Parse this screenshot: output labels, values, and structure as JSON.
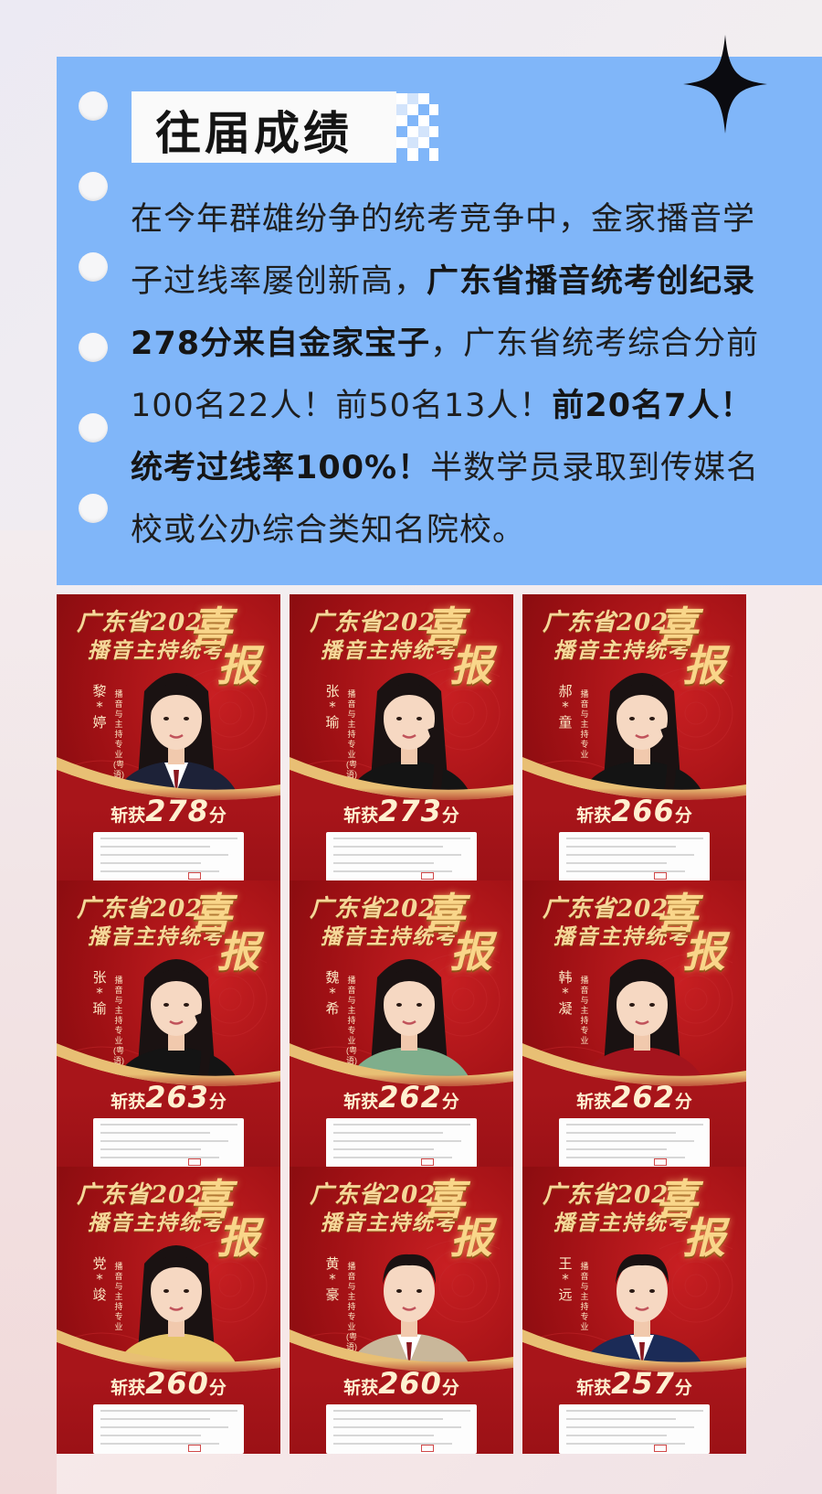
{
  "section": {
    "title": "往届成绩",
    "paragraph": [
      {
        "text": "在今年群雄纷争的统考竞争中，金家播音学子过线率屡创新高，",
        "bold": false
      },
      {
        "text": "广东省播音统考创纪录278分来自金家宝子",
        "bold": true
      },
      {
        "text": "，广东省统考综合分前100名22人！前50名13人！",
        "bold": false
      },
      {
        "text": "前20名7人！统考过线率100%！",
        "bold": true
      },
      {
        "text": "半数学员录取到传媒名校或公办综合类知名院校。",
        "bold": false
      }
    ]
  },
  "poster_common": {
    "line1": "广东省2024",
    "line2": "播音主持统考",
    "xi": "喜",
    "bao": "报",
    "prefix": "斩获",
    "suffix": "分"
  },
  "posters": [
    {
      "name": "黎*婷",
      "major": "播音与主持专业(粤语)",
      "score": "278",
      "hair": "long",
      "outfit": "suit"
    },
    {
      "name": "张*瑜",
      "major": "播音与主持专业(粤语)",
      "score": "273",
      "hair": "braid",
      "outfit": "black"
    },
    {
      "name": "郝*童",
      "major": "播音与主持专业",
      "score": "266",
      "hair": "braid",
      "outfit": "black"
    },
    {
      "name": "张*瑜",
      "major": "播音与主持专业(粤语)",
      "score": "263",
      "hair": "braid",
      "outfit": "black"
    },
    {
      "name": "魏*希",
      "major": "播音与主持专业(粤语)",
      "score": "262",
      "hair": "long",
      "outfit": "green"
    },
    {
      "name": "韩*凝",
      "major": "播音与主持专业",
      "score": "262",
      "hair": "long",
      "outfit": "red"
    },
    {
      "name": "党*竣",
      "major": "播音与主持专业",
      "score": "260",
      "hair": "long",
      "outfit": "yellow"
    },
    {
      "name": "黄*豪",
      "major": "播音与主持专业(粤语)",
      "score": "260",
      "hair": "short",
      "outfit": "beige"
    },
    {
      "name": "王*远",
      "major": "播音与主持专业",
      "score": "257",
      "hair": "short",
      "outfit": "navy"
    }
  ],
  "colors": {
    "card_blue": "#80b6f9",
    "poster_red": "#9e1014",
    "gold": "#f6d79a"
  },
  "icons": [
    "sparkle-star-icon",
    "pixel-checker-decoration"
  ]
}
